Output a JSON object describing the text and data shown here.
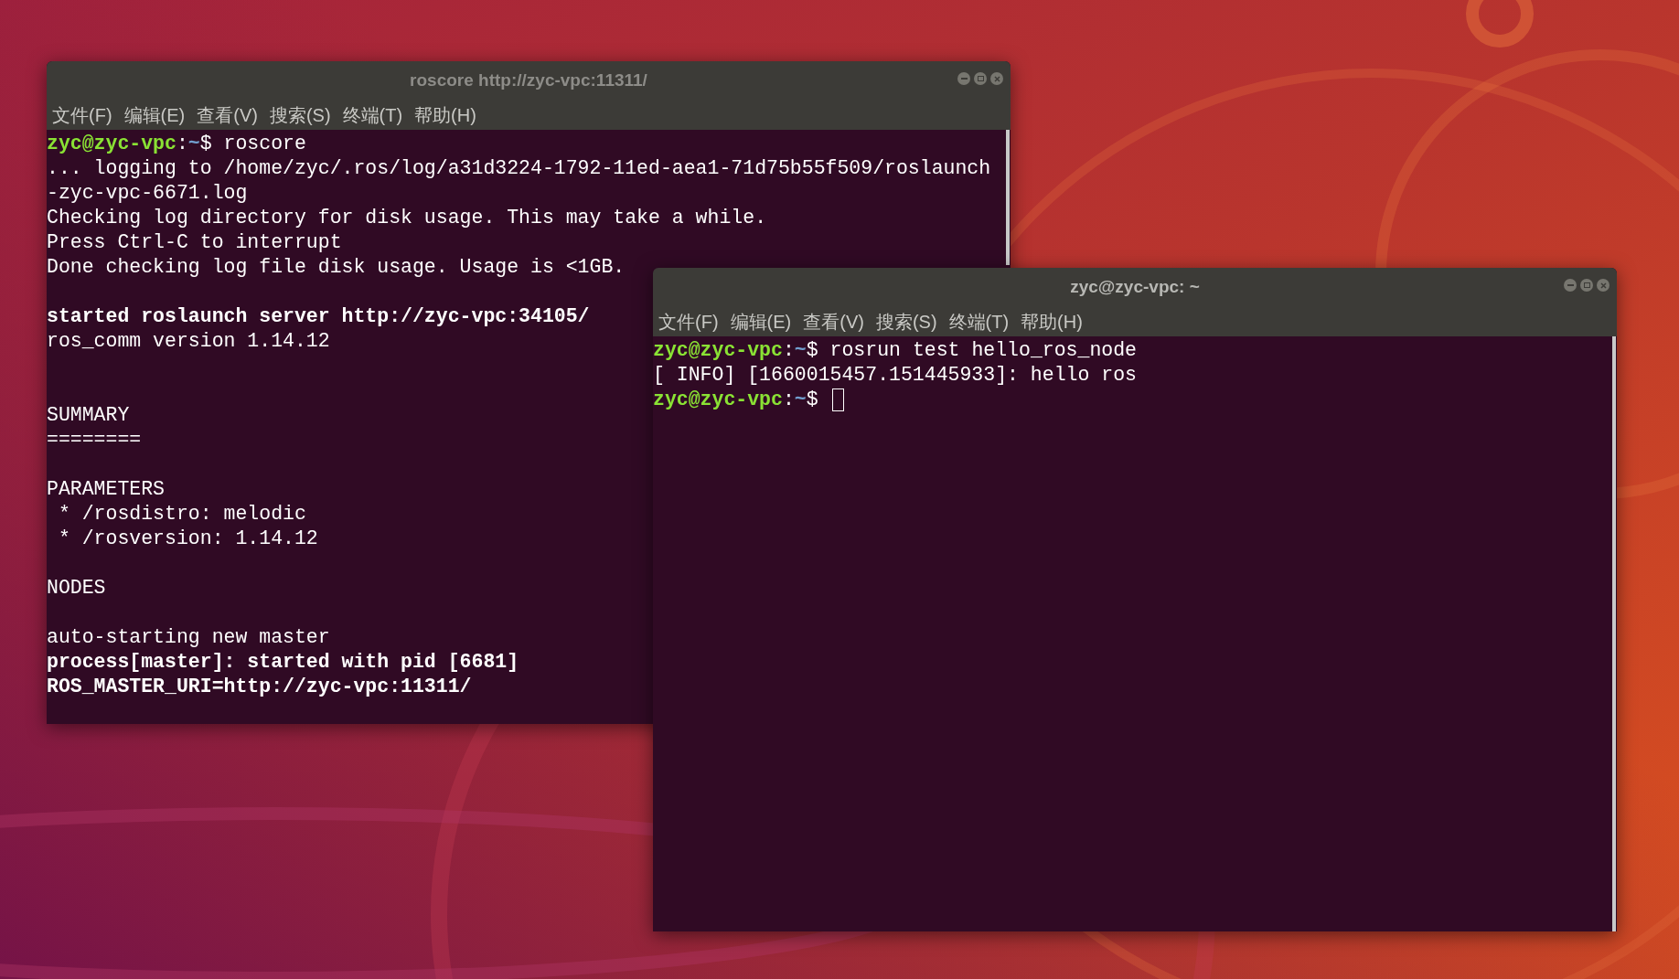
{
  "windows": [
    {
      "title": "roscore http://zyc-vpc:11311/",
      "focused": false,
      "menu": [
        "文件(F)",
        "编辑(E)",
        "查看(V)",
        "搜索(S)",
        "终端(T)",
        "帮助(H)"
      ],
      "lines": [
        {
          "kind": "prompt",
          "user": "zyc@zyc-vpc",
          "sep": ":",
          "path": "~",
          "symbol": "$",
          "command": "roscore",
          "cursor": false
        },
        {
          "kind": "plain",
          "text": "... logging to /home/zyc/.ros/log/a31d3224-1792-11ed-aea1-71d75b55f509/roslaunch"
        },
        {
          "kind": "plain",
          "text": "-zyc-vpc-6671.log"
        },
        {
          "kind": "plain",
          "text": "Checking log directory for disk usage. This may take a while."
        },
        {
          "kind": "plain",
          "text": "Press Ctrl-C to interrupt"
        },
        {
          "kind": "plain",
          "text": "Done checking log file disk usage. Usage is <1GB."
        },
        {
          "kind": "blank"
        },
        {
          "kind": "bold",
          "text": "started roslaunch server http://zyc-vpc:34105/"
        },
        {
          "kind": "plain",
          "text": "ros_comm version 1.14.12"
        },
        {
          "kind": "blank"
        },
        {
          "kind": "blank"
        },
        {
          "kind": "plain",
          "text": "SUMMARY"
        },
        {
          "kind": "plain",
          "text": "========"
        },
        {
          "kind": "blank"
        },
        {
          "kind": "plain",
          "text": "PARAMETERS"
        },
        {
          "kind": "plain",
          "text": " * /rosdistro: melodic"
        },
        {
          "kind": "plain",
          "text": " * /rosversion: 1.14.12"
        },
        {
          "kind": "blank"
        },
        {
          "kind": "plain",
          "text": "NODES"
        },
        {
          "kind": "blank"
        },
        {
          "kind": "plain",
          "text": "auto-starting new master"
        },
        {
          "kind": "bold",
          "text": "process[master]: started with pid [6681]"
        },
        {
          "kind": "bold",
          "text": "ROS_MASTER_URI=http://zyc-vpc:11311/"
        }
      ]
    },
    {
      "title": "zyc@zyc-vpc: ~",
      "focused": true,
      "menu": [
        "文件(F)",
        "编辑(E)",
        "查看(V)",
        "搜索(S)",
        "终端(T)",
        "帮助(H)"
      ],
      "lines": [
        {
          "kind": "prompt",
          "user": "zyc@zyc-vpc",
          "sep": ":",
          "path": "~",
          "symbol": "$",
          "command": "rosrun test hello_ros_node",
          "cursor": false
        },
        {
          "kind": "plain",
          "text": "[ INFO] [1660015457.151445933]: hello ros"
        },
        {
          "kind": "prompt",
          "user": "zyc@zyc-vpc",
          "sep": ":",
          "path": "~",
          "symbol": "$",
          "cursor": true
        }
      ]
    }
  ]
}
